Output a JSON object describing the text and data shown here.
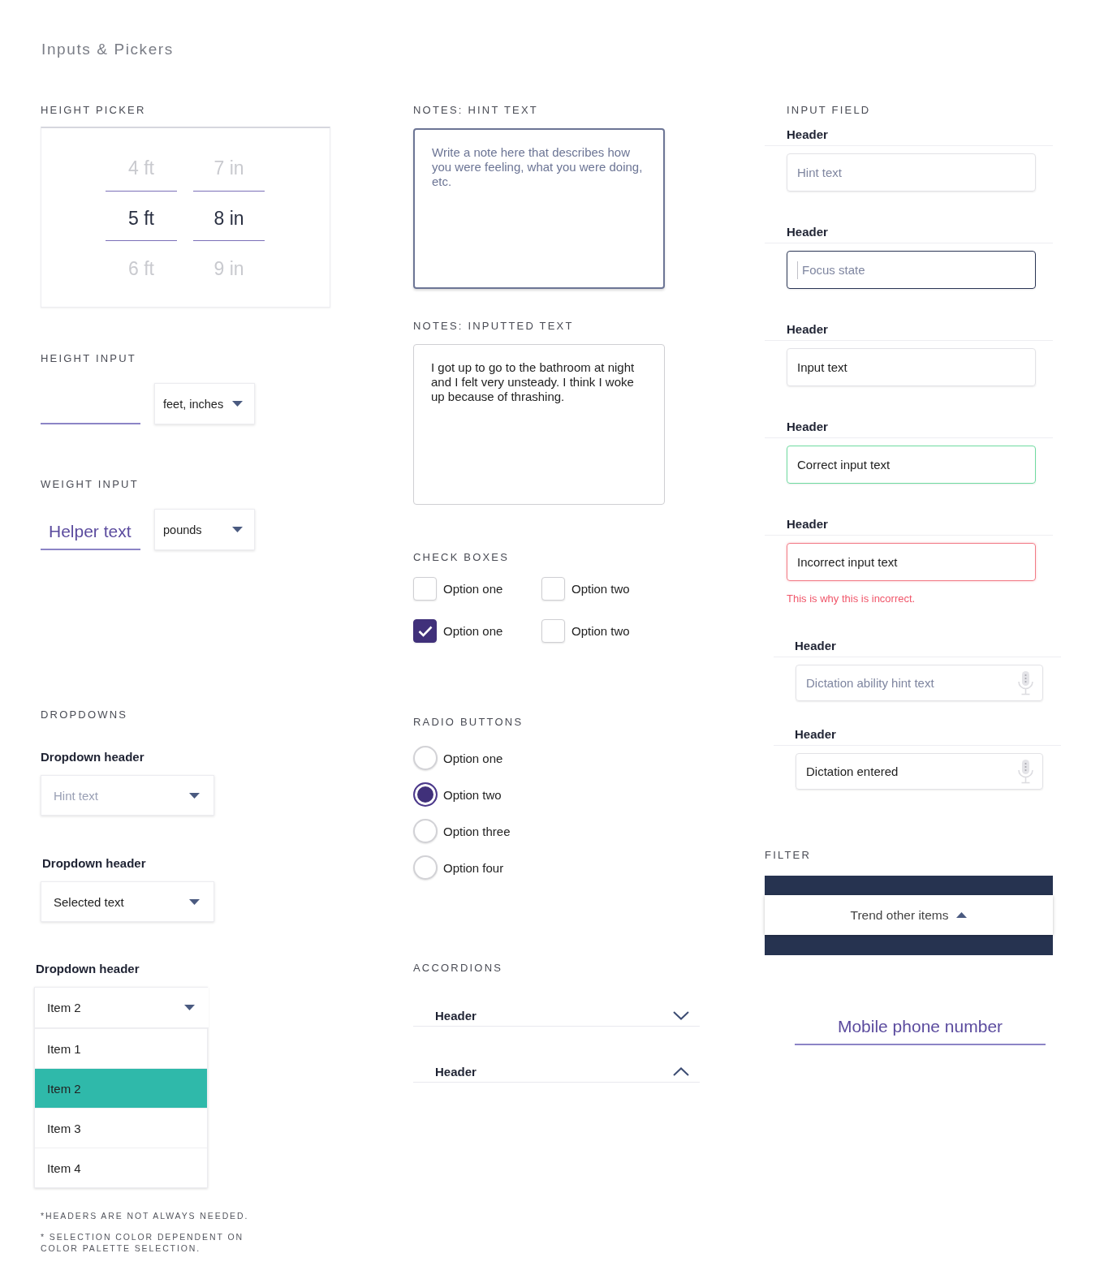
{
  "page_title": "Inputs & Pickers",
  "height_picker": {
    "label": "HEIGHT PICKER",
    "columns": [
      {
        "values": [
          {
            "text": "4 ft",
            "selected": false
          },
          {
            "text": "5 ft",
            "selected": true
          },
          {
            "text": "6 ft",
            "selected": false
          }
        ]
      },
      {
        "values": [
          {
            "text": "7 in",
            "selected": false
          },
          {
            "text": "8 in",
            "selected": true
          },
          {
            "text": "9 in",
            "selected": false
          }
        ]
      }
    ]
  },
  "height_input": {
    "label": "HEIGHT INPUT",
    "unit_dropdown": {
      "value": "feet, inches"
    }
  },
  "weight_input": {
    "label": "WEIGHT INPUT",
    "field": {
      "placeholder": "Helper text"
    },
    "unit_dropdown": {
      "value": "pounds"
    }
  },
  "dropdowns": {
    "label": "DROPDOWNS",
    "items": [
      {
        "header": "Dropdown header",
        "placeholder": "Hint text",
        "expanded": false
      },
      {
        "header": "Dropdown header",
        "value": "Selected text",
        "expanded": false
      },
      {
        "header": "Dropdown header",
        "value": "Item 2",
        "expanded": true,
        "options": [
          {
            "text": "Item 1",
            "selected": false
          },
          {
            "text": "Item 2",
            "selected": true
          },
          {
            "text": "Item 3",
            "selected": false
          },
          {
            "text": "Item 4",
            "selected": false
          }
        ]
      }
    ]
  },
  "footnotes": [
    "*HEADERS ARE NOT ALWAYS NEEDED.",
    "* SELECTION COLOR DEPENDENT ON COLOR PALETTE SELECTION."
  ],
  "notes": [
    {
      "label": "NOTES: HINT TEXT",
      "placeholder": "Write a note here that describes how you were feeling, what you were doing, etc.",
      "focused": true
    },
    {
      "label": "NOTES: INPUTTED TEXT",
      "value": "I got up to go to the bathroom at night and I felt very unsteady. I think I woke up because of thrashing.",
      "focused": false
    }
  ],
  "checkboxes": {
    "label": "CHECK BOXES",
    "items": [
      {
        "text": "Option one",
        "checked": false
      },
      {
        "text": "Option two",
        "checked": false
      },
      {
        "text": "Option one",
        "checked": true
      },
      {
        "text": "Option two",
        "checked": false
      }
    ]
  },
  "radio_buttons": {
    "label": "RADIO BUTTONS",
    "options": [
      {
        "text": "Option one",
        "selected": false
      },
      {
        "text": "Option two",
        "selected": true
      },
      {
        "text": "Option three",
        "selected": false
      },
      {
        "text": "Option four",
        "selected": false
      }
    ]
  },
  "accordions": {
    "label": "ACCORDIONS",
    "items": [
      {
        "header": "Header",
        "expanded": false
      },
      {
        "header": "Header",
        "expanded": true
      }
    ]
  },
  "input_field": {
    "label": "INPUT FIELD",
    "items": [
      {
        "kind": "text",
        "header": "Header",
        "focused": false,
        "valid": false,
        "invalid": false,
        "placeholder": "Hint text"
      },
      {
        "kind": "text",
        "header": "Header",
        "focused": true,
        "valid": false,
        "invalid": false,
        "placeholder": "Focus state"
      },
      {
        "kind": "text",
        "header": "Header",
        "focused": false,
        "valid": false,
        "invalid": false,
        "value": "Input text"
      },
      {
        "kind": "text",
        "header": "Header",
        "focused": false,
        "valid": true,
        "invalid": false,
        "value": "Correct input text"
      },
      {
        "kind": "text",
        "header": "Header",
        "focused": false,
        "valid": false,
        "invalid": true,
        "value": "Incorrect input text",
        "error": "This is why this is incorrect."
      },
      {
        "kind": "dictation",
        "header": "Header",
        "focused": false,
        "valid": false,
        "invalid": false,
        "placeholder": "Dictation ability hint text"
      },
      {
        "kind": "dictation",
        "header": "Header",
        "focused": false,
        "valid": false,
        "invalid": false,
        "value": "Dictation entered"
      }
    ]
  },
  "filter": {
    "label": "FILTER",
    "toggle": {
      "text": "Trend other items",
      "expanded": true
    }
  },
  "phone_field": {
    "placeholder": "Mobile phone number"
  }
}
